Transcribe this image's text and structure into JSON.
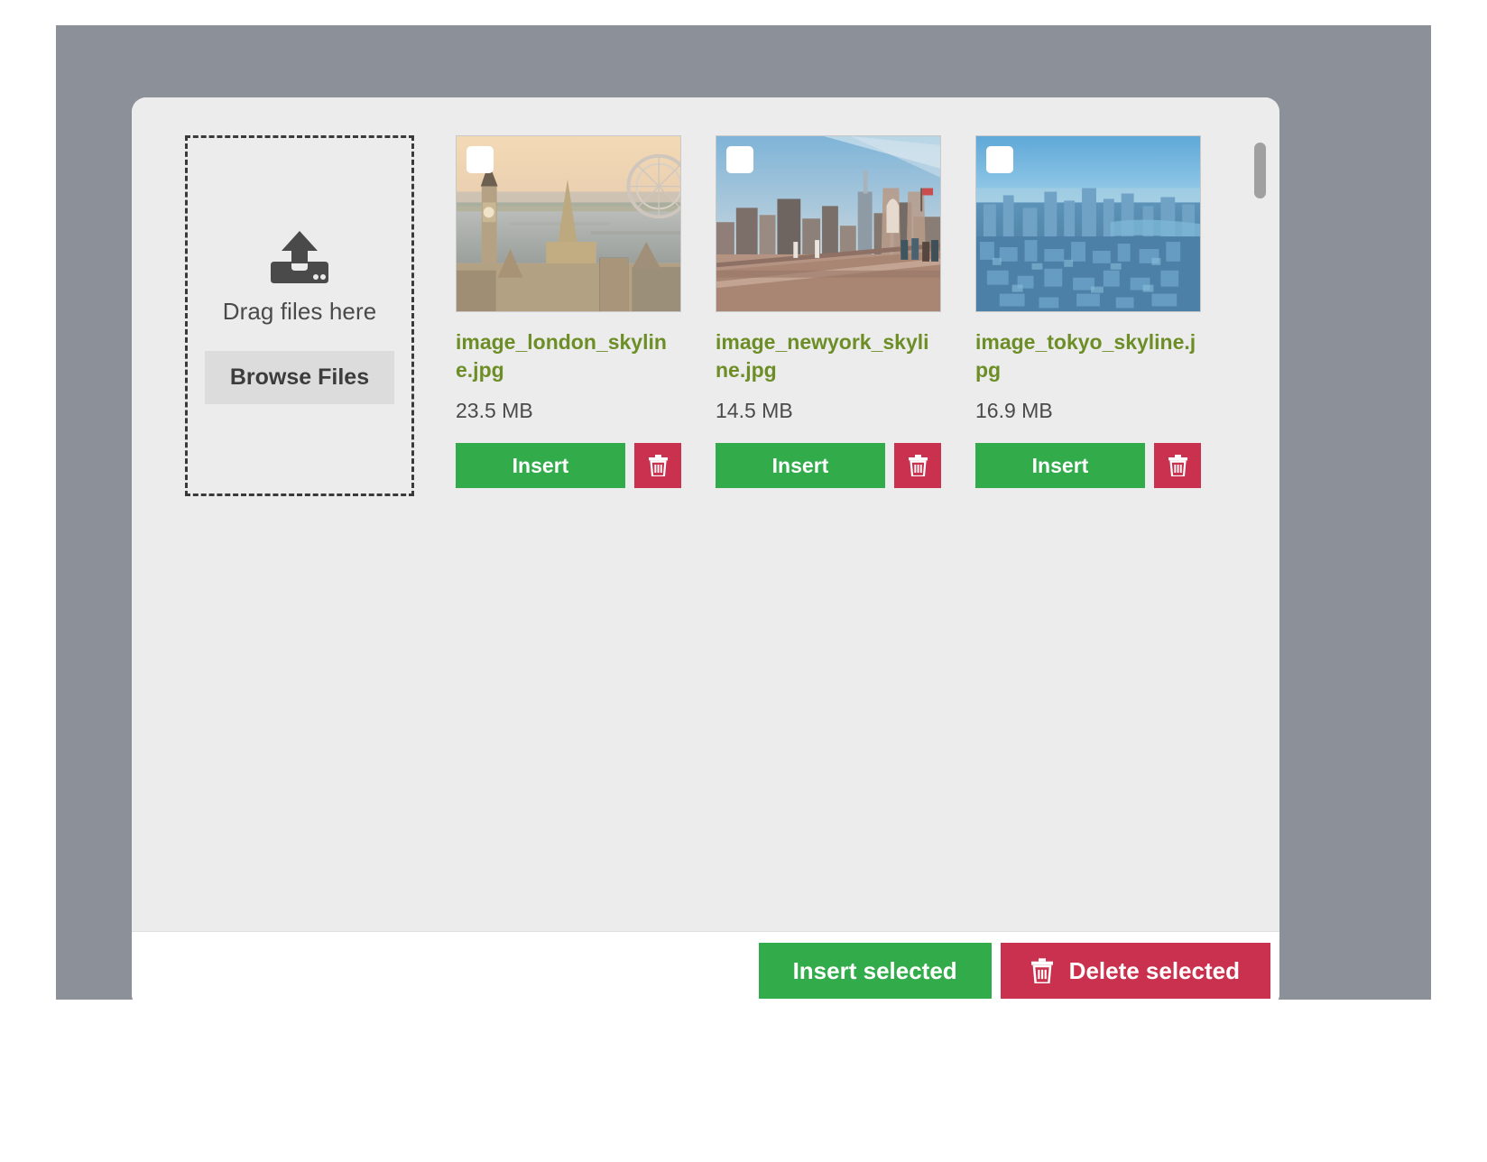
{
  "dialog": {
    "dropzone": {
      "icon": "upload-icon",
      "label": "Drag files here",
      "browse_label": "Browse Files"
    },
    "files": [
      {
        "name": "image_london_skyline.jpg",
        "size": "23.5 MB",
        "insert_label": "Insert",
        "delete_icon": "trash-icon",
        "checkbox_checked": false,
        "thumbnail_alt": "london-skyline-thumbnail"
      },
      {
        "name": "image_newyork_skyline.jpg",
        "size": "14.5 MB",
        "insert_label": "Insert",
        "delete_icon": "trash-icon",
        "checkbox_checked": false,
        "thumbnail_alt": "newyork-skyline-thumbnail"
      },
      {
        "name": "image_tokyo_skyline.jpg",
        "size": "16.9 MB",
        "insert_label": "Insert",
        "delete_icon": "trash-icon",
        "checkbox_checked": false,
        "thumbnail_alt": "tokyo-skyline-thumbnail"
      }
    ],
    "footer": {
      "insert_selected_label": "Insert selected",
      "delete_selected_label": "Delete selected",
      "delete_selected_icon": "trash-icon"
    }
  },
  "colors": {
    "backdrop": "#8b9099",
    "dialog_bg": "#ececec",
    "footer_bg": "#ffffff",
    "green": "#32ab4b",
    "red": "#ca314e",
    "filename": "#6d8e26",
    "browse_bg": "#dcdcdc",
    "scrollbar_thumb": "#a0a0a0"
  }
}
